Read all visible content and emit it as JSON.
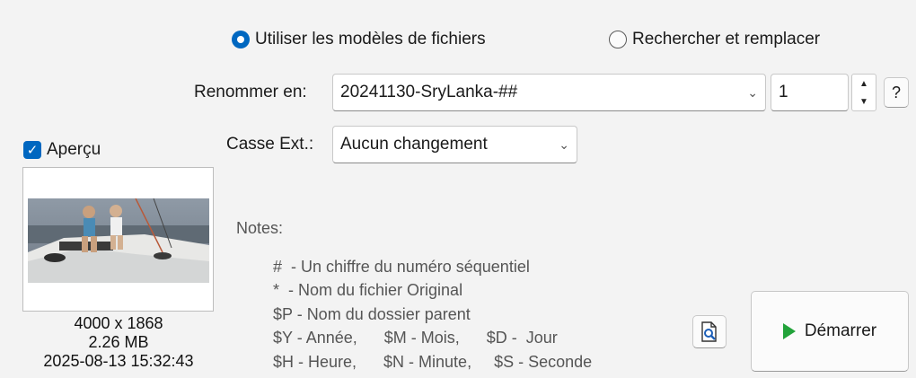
{
  "mode": {
    "option_templates": "Utiliser les modèles de fichiers",
    "option_search_replace": "Rechercher et remplacer",
    "selected": "templates"
  },
  "rename": {
    "label": "Renommer en:",
    "value": "20241130-SryLanka-##",
    "counter_value": "1",
    "help_label": "?"
  },
  "case_ext": {
    "label": "Casse Ext.:",
    "value": "Aucun changement"
  },
  "preview": {
    "checkbox_label": "Aperçu",
    "checked": true,
    "dimensions": "4000 x 1868",
    "size": "2.26 MB",
    "datetime": "2025-08-13 15:32:43"
  },
  "notes": {
    "title": "Notes:",
    "lines": [
      "#  - Un chiffre du numéro séquentiel",
      "*  - Nom du fichier Original",
      "$P - Nom du dossier parent",
      "$Y - Année,      $M - Mois,      $D -  Jour",
      "$H - Heure,      $N - Minute,     $S - Seconde"
    ]
  },
  "actions": {
    "start_label": "Démarrer"
  },
  "colors": {
    "accent": "#0067c0",
    "start_arrow": "#22a33a"
  }
}
